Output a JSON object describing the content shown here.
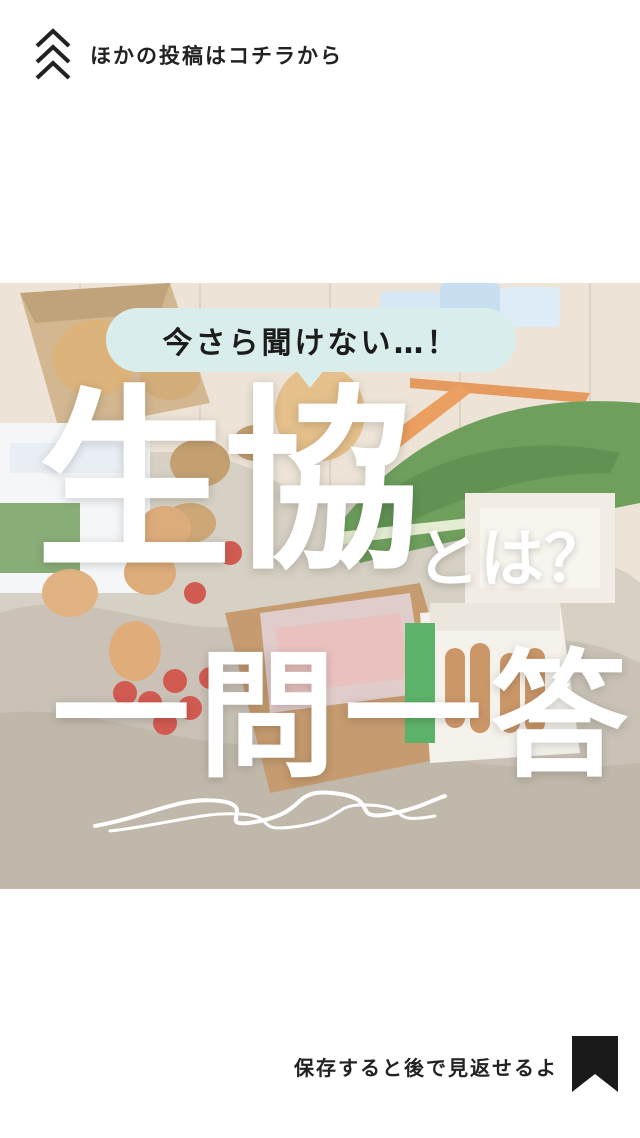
{
  "header": {
    "link_label": "ほかの投稿はコチラから",
    "icon": "chevrons-up-icon"
  },
  "hero": {
    "bubble_text": "今さら聞けない…！",
    "title_main": "生協",
    "title_sub": "とは？",
    "title_line2": "一問一答"
  },
  "footer": {
    "save_label": "保存すると後で見返せるよ",
    "icon": "bookmark-icon"
  }
}
